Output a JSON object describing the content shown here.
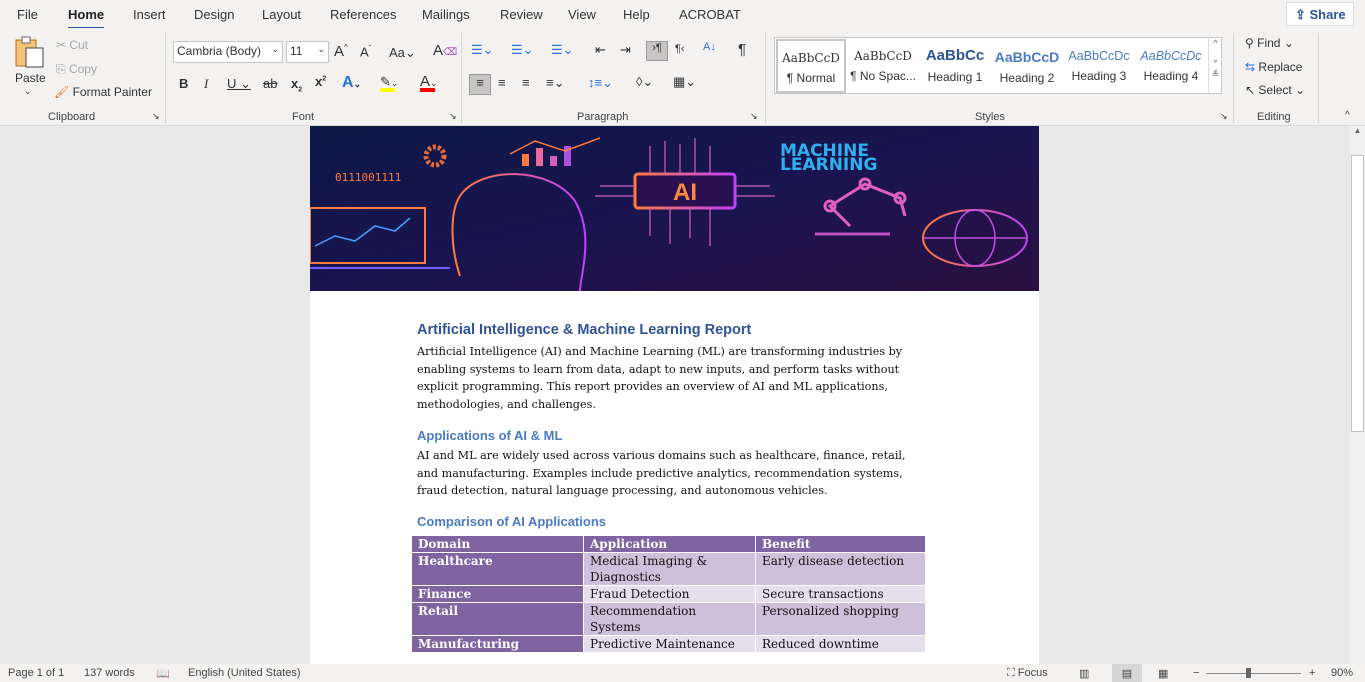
{
  "tabs": [
    "File",
    "Home",
    "Insert",
    "Design",
    "Layout",
    "References",
    "Mailings",
    "Review",
    "View",
    "Help",
    "ACROBAT"
  ],
  "share_label": "Share",
  "clipboard": {
    "paste": "Paste",
    "cut": "Cut",
    "copy": "Copy",
    "format_painter": "Format Painter",
    "label": "Clipboard"
  },
  "font": {
    "name": "Cambria (Body)",
    "size": "11",
    "label": "Font",
    "highlight_color": "#ffff00",
    "font_color": "#ff0000"
  },
  "paragraph": {
    "label": "Paragraph"
  },
  "styles": {
    "label": "Styles",
    "items": [
      {
        "preview": "AaBbCcD",
        "name": "¶ Normal"
      },
      {
        "preview": "AaBbCcD",
        "name": "¶ No Spac..."
      },
      {
        "preview": "AaBbCc",
        "name": "Heading 1"
      },
      {
        "preview": "AaBbCcD",
        "name": "Heading 2"
      },
      {
        "preview": "AaBbCcDc",
        "name": "Heading 3"
      },
      {
        "preview": "AaBbCcDc",
        "name": "Heading 4"
      }
    ]
  },
  "editing": {
    "label": "Editing",
    "find": "Find",
    "replace": "Replace",
    "select": "Select"
  },
  "banner": {
    "title1": "MACHINE",
    "title2": "LEARNING",
    "chip": "AI",
    "binary": "0111001111"
  },
  "document": {
    "title": "Artificial Intelligence & Machine Learning Report",
    "intro": "Artificial Intelligence (AI) and Machine Learning (ML) are transforming industries by enabling systems to learn from data, adapt to new inputs, and perform tasks without explicit programming. This report provides an overview of AI and ML applications, methodologies, and challenges.",
    "h_applications": "Applications of AI & ML",
    "applications": "AI and ML are widely used across various domains such as healthcare, finance, retail, and manufacturing. Examples include predictive analytics, recommendation systems, fraud detection, natural language processing, and autonomous vehicles.",
    "h_comparison": "Comparison of AI Applications",
    "table": {
      "headers": [
        "Domain",
        "Application",
        "Benefit"
      ],
      "rows": [
        [
          "Healthcare",
          "Medical Imaging & Diagnostics",
          "Early disease detection"
        ],
        [
          "Finance",
          "Fraud Detection",
          "Secure transactions"
        ],
        [
          "Retail",
          "Recommendation Systems",
          "Personalized shopping"
        ],
        [
          "Manufacturing",
          "Predictive Maintenance",
          "Reduced downtime"
        ]
      ]
    }
  },
  "status": {
    "page": "Page 1 of 1",
    "words": "137 words",
    "language": "English (United States)",
    "focus": "Focus",
    "zoom": "90%",
    "zoom_level_percent": 90
  }
}
